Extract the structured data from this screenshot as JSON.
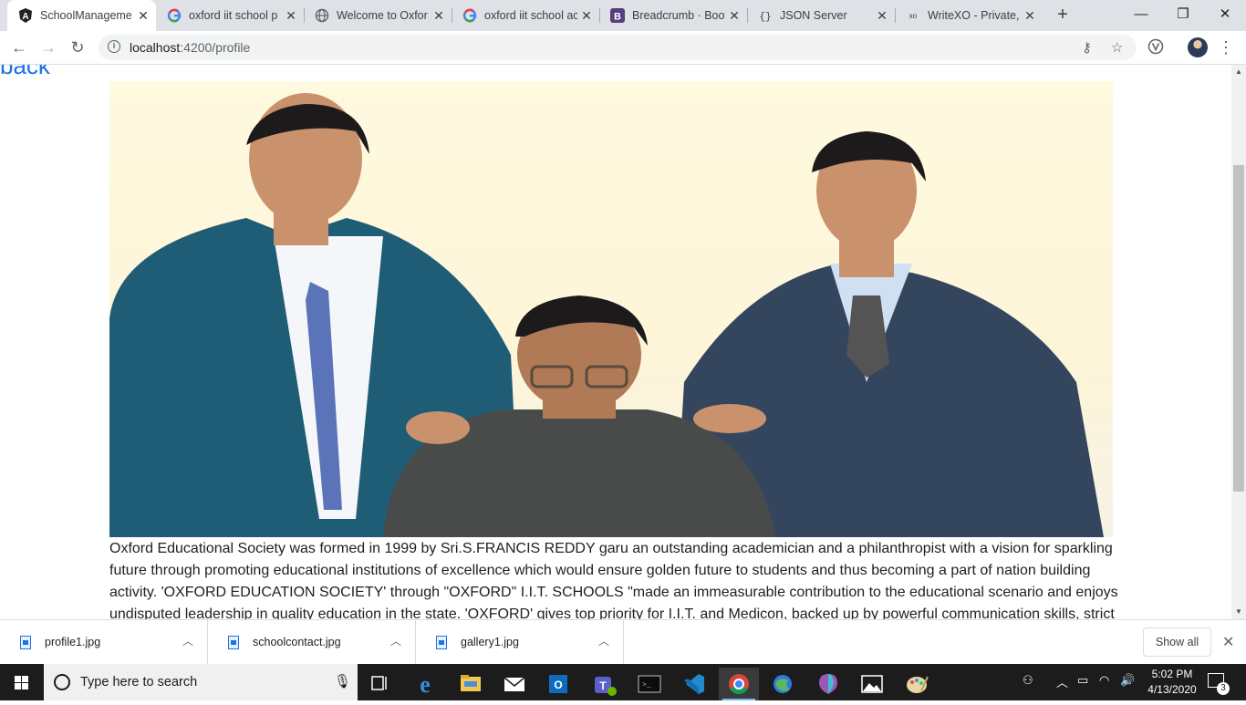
{
  "tabs": [
    {
      "title": "SchoolManageme",
      "icon": "angular-icon",
      "active": true
    },
    {
      "title": "oxford iit school p",
      "icon": "google-icon"
    },
    {
      "title": "Welcome to Oxfor",
      "icon": "globe-icon"
    },
    {
      "title": "oxford iit school ac",
      "icon": "google-icon"
    },
    {
      "title": "Breadcrumb · Boot",
      "icon": "bootstrap-icon"
    },
    {
      "title": "JSON Server",
      "icon": "json-server-icon"
    },
    {
      "title": "WriteXO - Private,",
      "icon": "writexo-icon"
    }
  ],
  "address_bar": {
    "host": "localhost",
    "path": ":4200/profile"
  },
  "page": {
    "back_link": "back",
    "photo_alt": "profile1.jpg",
    "description": "Oxford Educational Society was formed in 1999 by Sri.S.FRANCIS REDDY garu an outstanding academician and a philanthropist with a vision for sparkling future through promoting educational institutions of excellence which would ensure golden future to students and thus becoming a part of nation building activity. 'OXFORD EDUCATION SOCIETY' through \"OXFORD\" I.I.T. SCHOOLS \"made an immeasurable contribution to the educational scenario and enjoys undisputed leadership in quality education in the state. 'OXFORD' gives top priority for I.I.T. and Medicon, backed up by powerful communication skills, strict"
  },
  "downloads": [
    {
      "name": "profile1.jpg"
    },
    {
      "name": "schoolcontact.jpg"
    },
    {
      "name": "gallery1.jpg"
    }
  ],
  "downloads_show_all": "Show all",
  "taskbar": {
    "search_placeholder": "Type here to search",
    "time": "5:02 PM",
    "date": "4/13/2020",
    "notification_count": "3"
  },
  "colors": {
    "link": "#1a73e8",
    "taskbar": "#1c1c1c",
    "tab_strip": "#dee1e6"
  }
}
